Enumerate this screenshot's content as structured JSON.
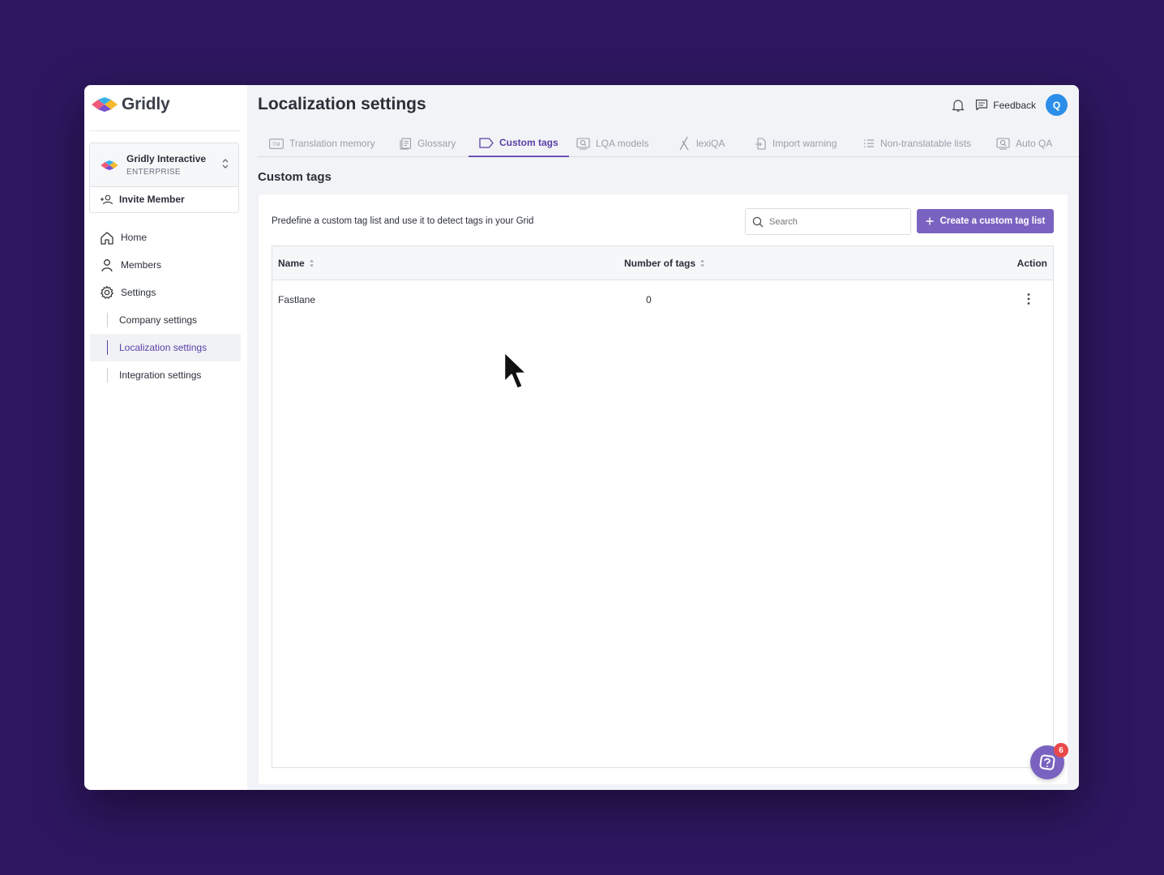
{
  "app": {
    "logo_text": "Gridly"
  },
  "org": {
    "name": "Gridly Interactive",
    "plan": "ENTERPRISE",
    "invite_label": "Invite Member"
  },
  "sidebar": {
    "items": [
      {
        "label": "Home",
        "icon": "home-icon"
      },
      {
        "label": "Members",
        "icon": "person-icon"
      },
      {
        "label": "Settings",
        "icon": "gear-icon"
      }
    ],
    "sub_items": [
      {
        "label": "Company settings",
        "active": false
      },
      {
        "label": "Localization settings",
        "active": true
      },
      {
        "label": "Integration settings",
        "active": false
      }
    ]
  },
  "header": {
    "title": "Localization settings",
    "feedback_label": "Feedback",
    "avatar_initial": "Q"
  },
  "tabs": [
    {
      "label": "Translation memory",
      "icon": "tm-icon"
    },
    {
      "label": "Glossary",
      "icon": "glossary-icon"
    },
    {
      "label": "Custom tags",
      "icon": "tag-icon",
      "active": true
    },
    {
      "label": "LQA models",
      "icon": "lqa-icon"
    },
    {
      "label": "lexiQA",
      "icon": "lexiqa-icon"
    },
    {
      "label": "Import warning",
      "icon": "import-icon"
    },
    {
      "label": "Non-translatable lists",
      "icon": "list-icon"
    },
    {
      "label": "Auto QA",
      "icon": "autoqa-icon"
    }
  ],
  "content": {
    "section_title": "Custom tags",
    "description": "Predefine a custom tag list and use it to detect tags in your Grid",
    "search_placeholder": "Search",
    "create_button": "Create a custom tag list",
    "table": {
      "columns": [
        "Name",
        "Number of tags",
        "Action"
      ],
      "rows": [
        {
          "name": "Fastlane",
          "count": "0"
        }
      ]
    }
  },
  "help": {
    "badge_count": "6"
  },
  "colors": {
    "accent": "#7a63c0",
    "active_text": "#5b3fa6",
    "background": "#2e1760",
    "avatar": "#2b8ee8",
    "badge": "#e8484a"
  }
}
